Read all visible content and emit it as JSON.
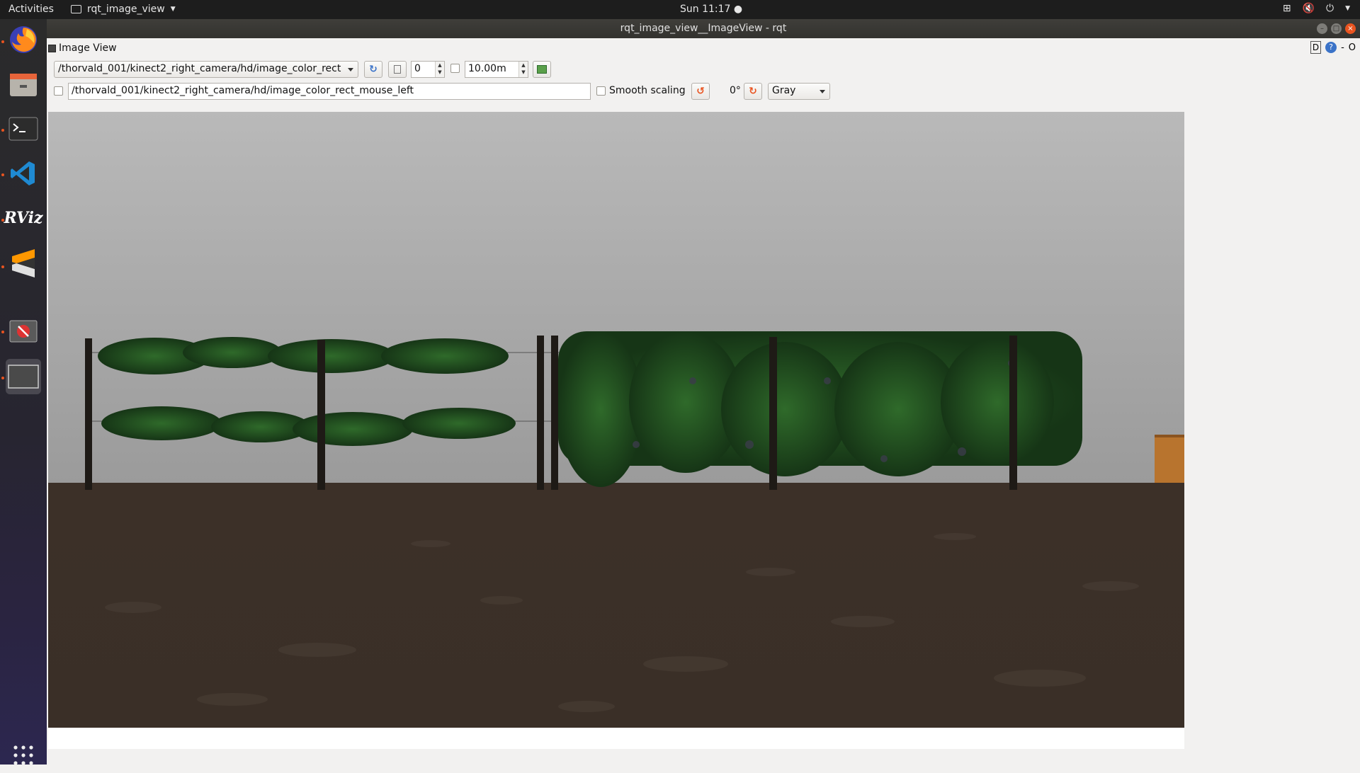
{
  "topbar": {
    "activities": "Activities",
    "app_name": "rqt_image_view",
    "clock": "Sun 11:17 ●"
  },
  "window": {
    "title": "rqt_image_view__ImageView - rqt"
  },
  "dockwidget": {
    "title": "Image View",
    "right_labels": [
      "D",
      "?",
      "-",
      "O"
    ]
  },
  "toolbar": {
    "topic": "/thorvald_001/kinect2_right_camera/hd/image_color_rect",
    "spin_value": "0",
    "max_range": "10.00m",
    "mouse_topic": "/thorvald_001/kinect2_right_camera/hd/image_color_rect_mouse_left",
    "smooth_scaling_label": "Smooth scaling",
    "rotation": "0°",
    "color_scheme": "Gray"
  },
  "dock": {
    "apps": [
      "firefox-icon",
      "files-icon",
      "terminal-icon",
      "vscode-icon",
      "rviz-icon",
      "sublime-icon",
      "rqt-icon",
      "window-icon"
    ]
  },
  "colors": {
    "accent": "#e95420",
    "sky_top": "#b7b7b7",
    "sky_bottom": "#9a9a9a",
    "ground": "#3b2f26",
    "foliage": "#1f4a1f"
  }
}
